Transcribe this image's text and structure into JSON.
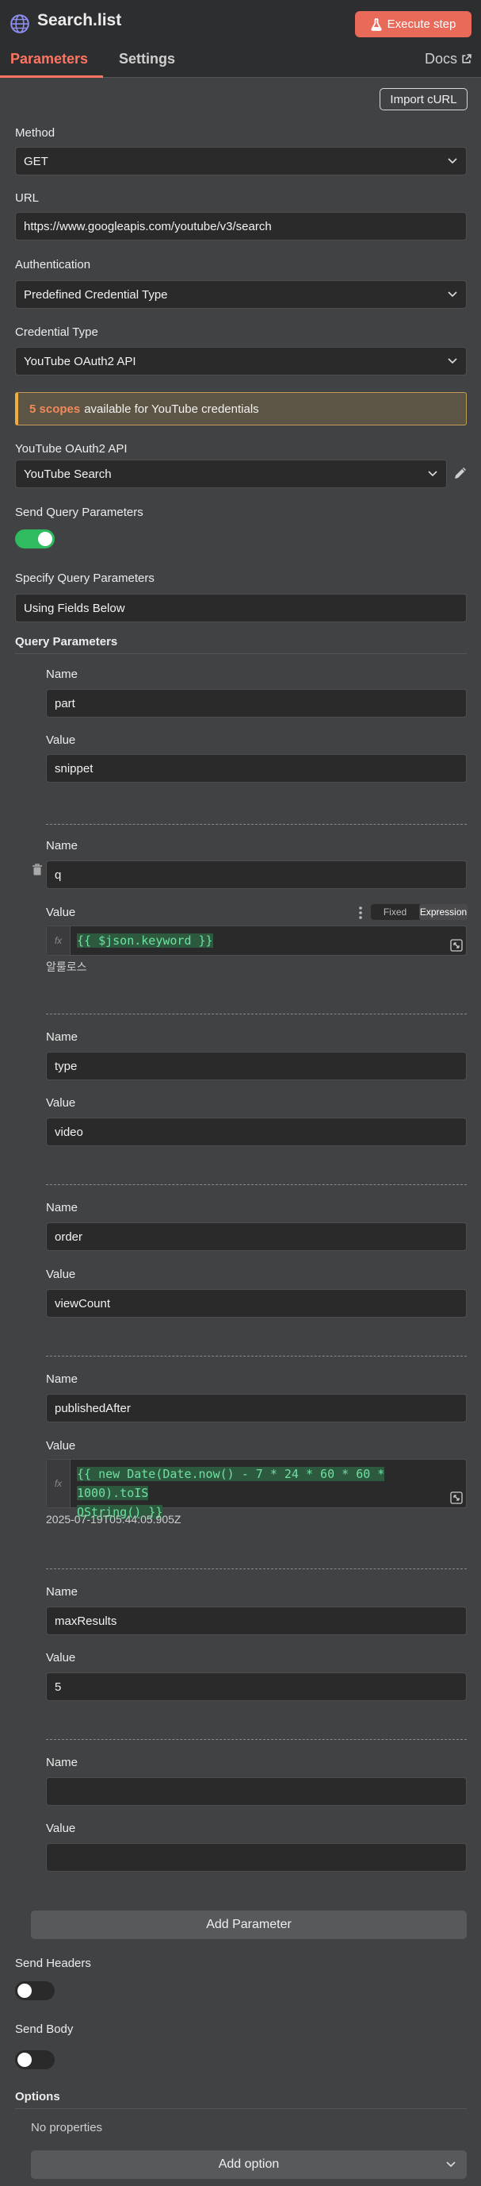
{
  "header": {
    "title": "Search.list",
    "execute_label": "Execute step",
    "icon_name": "globe-icon",
    "accent_color": "#ea6a5a"
  },
  "tabs": {
    "parameters": "Parameters",
    "settings": "Settings",
    "docs": "Docs"
  },
  "import_curl": "Import cURL",
  "method": {
    "label": "Method",
    "value": "GET"
  },
  "url": {
    "label": "URL",
    "value": "https://www.googleapis.com/youtube/v3/search"
  },
  "authentication": {
    "label": "Authentication",
    "value": "Predefined Credential Type"
  },
  "credential_type": {
    "label": "Credential Type",
    "value": "YouTube OAuth2 API"
  },
  "notice": {
    "count": "5 scopes",
    "text": "available for YouTube credentials"
  },
  "credential": {
    "label": "YouTube OAuth2 API",
    "value": "YouTube Search"
  },
  "send_query": {
    "label": "Send Query Parameters",
    "enabled": true
  },
  "specify_query": {
    "label": "Specify Query Parameters",
    "value": "Using Fields Below"
  },
  "query_params": {
    "label": "Query Parameters",
    "name_label": "Name",
    "value_label": "Value",
    "fixed_label": "Fixed",
    "expression_label": "Expression",
    "fx_label": "fx",
    "items": [
      {
        "name": "part",
        "value": "snippet"
      },
      {
        "name": "q",
        "value_expr": "{{ $json.keyword }}",
        "preview": "알룰로스"
      },
      {
        "name": "type",
        "value": "video"
      },
      {
        "name": "order",
        "value": "viewCount"
      },
      {
        "name": "publishedAfter",
        "value_expr_line1": "{{ new Date(Date.now() - 7 * 24 * 60 * 60 * 1000).toIS",
        "value_expr_line2": "OString() }}",
        "preview": "2025-07-19T05:44:05.905Z"
      },
      {
        "name": "maxResults",
        "value": "5"
      },
      {
        "name": "",
        "value": ""
      }
    ]
  },
  "add_parameter": "Add Parameter",
  "send_headers": {
    "label": "Send Headers",
    "enabled": false
  },
  "send_body": {
    "label": "Send Body",
    "enabled": false
  },
  "options": {
    "label": "Options",
    "empty_text": "No properties",
    "add_option": "Add option"
  }
}
